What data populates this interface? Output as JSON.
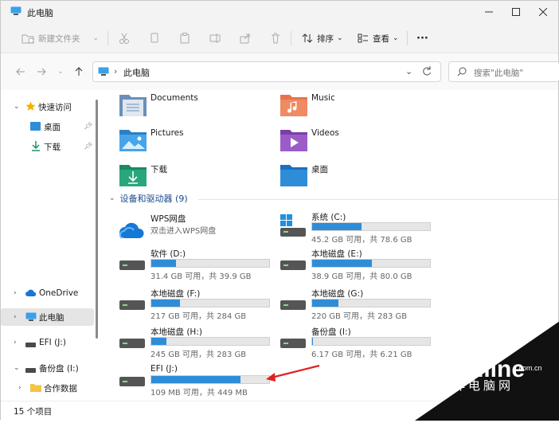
{
  "window": {
    "title": "此电脑"
  },
  "toolbar": {
    "new_folder": "新建文件夹",
    "sort": "排序",
    "view": "查看",
    "more": "···"
  },
  "address": {
    "path": "此电脑",
    "search_placeholder": "搜索\"此电脑\""
  },
  "sidebar": {
    "items": [
      {
        "label": "快速访问"
      },
      {
        "label": "桌面"
      },
      {
        "label": "下载"
      },
      {
        "label": "OneDrive"
      },
      {
        "label": "此电脑"
      },
      {
        "label": "EFI (J:)"
      },
      {
        "label": "备份盘 (I:)"
      },
      {
        "label": "合作数据"
      }
    ]
  },
  "folders": [
    {
      "label": "Documents"
    },
    {
      "label": "Music"
    },
    {
      "label": "Pictures"
    },
    {
      "label": "Videos"
    },
    {
      "label": "下载"
    },
    {
      "label": "桌面"
    }
  ],
  "devices_section": "设备和驱动器 (9)",
  "drives": [
    {
      "name": "WPS网盘",
      "sub": "双击进入WPS网盘",
      "fill": null
    },
    {
      "name": "系统 (C:)",
      "sub": "45.2 GB 可用，共 78.6 GB",
      "fill": 0.42
    },
    {
      "name": "软件 (D:)",
      "sub": "31.4 GB 可用，共 39.9 GB",
      "fill": 0.21
    },
    {
      "name": "本地磁盘 (E:)",
      "sub": "38.9 GB 可用，共 80.0 GB",
      "fill": 0.51
    },
    {
      "name": "本地磁盘 (F:)",
      "sub": "217 GB 可用，共 284 GB",
      "fill": 0.24
    },
    {
      "name": "本地磁盘 (G:)",
      "sub": "220 GB 可用，共 283 GB",
      "fill": 0.22
    },
    {
      "name": "本地磁盘 (H:)",
      "sub": "245 GB 可用，共 283 GB",
      "fill": 0.13
    },
    {
      "name": "备份盘 (I:)",
      "sub": "6.17 GB 可用，共 6.21 GB",
      "fill": 0.01
    },
    {
      "name": "EFI (J:)",
      "sub": "109 MB 可用，共 449 MB",
      "fill": 0.76
    }
  ],
  "status": {
    "count": "15 个项目"
  },
  "watermark": {
    "brand": "PConline",
    "domain": ".com.cn",
    "cn": "太平洋电脑网"
  },
  "colors": {
    "accent": "#2f8dd8",
    "arrow": "#e02020"
  }
}
